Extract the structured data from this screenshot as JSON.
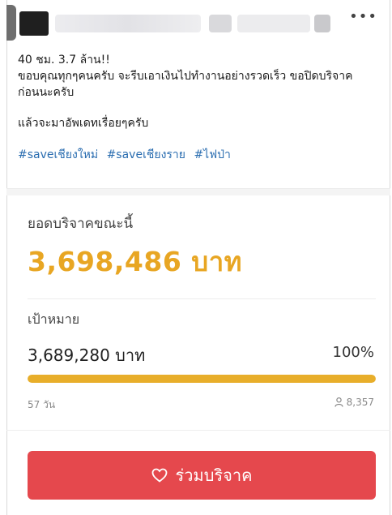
{
  "post": {
    "line1": "40 ชม. 3.7 ล้าน!!",
    "line2": "ขอบคุณทุกๆคนครับ จะรีบเอาเงินไปทำงานอย่างรวดเร็ว ขอปิดบริจาค",
    "line3": "ก่อนนะครับ",
    "line4": "แล้วจะมาอัพเดทเรื่อยๆครับ",
    "hashtags": [
      "#saveเชียงใหม่",
      "#saveเชียงราย",
      "#ไฟป่า"
    ]
  },
  "donation": {
    "current_label": "ยอดบริจาคขณะนี้",
    "current_amount": "3,698,486 บาท",
    "goal_label": "เป้าหมาย",
    "goal_amount": "3,689,280 บาท",
    "percent": "100%",
    "progress_fraction": 1.0,
    "days": "57 วัน",
    "donors": "8,357"
  },
  "actions": {
    "donate_label": "ร่วมบริจาค",
    "more_icon": "more-horizontal-icon"
  },
  "colors": {
    "amount": "#e8a623",
    "progress": "#e8ae2a",
    "button": "#e5484d",
    "hashtag": "#2a6db0"
  }
}
